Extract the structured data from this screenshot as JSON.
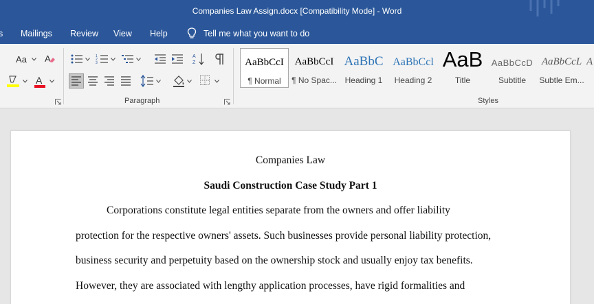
{
  "window": {
    "title": "Companies Law Assign.docx [Compatibility Mode]  -  Word"
  },
  "menu": {
    "tabs": [
      "s",
      "Mailings",
      "Review",
      "View",
      "Help"
    ],
    "tell_me": "Tell me what you want to do"
  },
  "ribbon": {
    "font_group": {
      "case_label": "Aa"
    },
    "paragraph_group": {
      "label": "Paragraph"
    },
    "styles_group": {
      "label": "Styles",
      "items": [
        {
          "sample": "AaBbCcI",
          "name": "¶ Normal"
        },
        {
          "sample": "AaBbCcI",
          "name": "¶ No Spac..."
        },
        {
          "sample": "AaBbC",
          "name": "Heading 1"
        },
        {
          "sample": "AaBbCcl",
          "name": "Heading 2"
        },
        {
          "sample": "AaB",
          "name": "Title"
        },
        {
          "sample": "AaBbCcD",
          "name": "Subtitle"
        },
        {
          "sample": "AaBbCcL",
          "name": "Subtle Em..."
        },
        {
          "sample": "A",
          "name": ""
        }
      ]
    },
    "colors": {
      "highlight": "#ffff00",
      "font_color": "#e81123",
      "accent": "#2b579a"
    }
  },
  "document": {
    "heading": "Companies Law",
    "subheading": "Saudi Construction Case Study Part 1",
    "lines": [
      "Corporations constitute legal entities separate from the owners and offer liability",
      "protection for the respective owners' assets. Such businesses provide personal liability protection,",
      "business security and perpetuity based on the ownership stock and usually enjoy tax benefits.",
      "However, they are associated with lengthy application processes, have rigid formalities and"
    ]
  }
}
